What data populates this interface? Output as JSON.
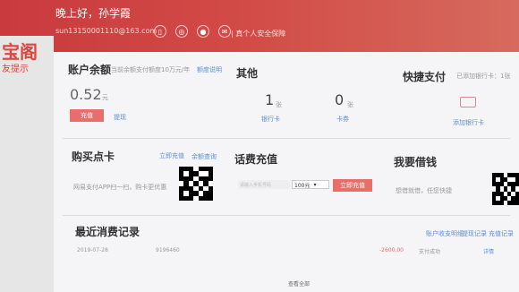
{
  "header": {
    "greeting": "晚上好，孙学霞",
    "email": "sun13150001110@163.com",
    "certified": "| 真个人安全保障"
  },
  "left": {
    "logo_top": "宝阁",
    "logo_bottom": "友提示"
  },
  "balance": {
    "title": "账户余额",
    "note": "当前余额支付额度10万元/年",
    "note_link": "额度说明",
    "amount": "0.52",
    "unit": "元",
    "recharge": "充值",
    "withdraw": "提现"
  },
  "other": {
    "title": "其他",
    "bank_count": "1",
    "bank_unit": "张",
    "bank_label": "银行卡",
    "card_count": "0",
    "card_unit": "张",
    "card_label": "卡券"
  },
  "quick_pay": {
    "title": "快捷支付",
    "note": "已添加银行卡：1张",
    "add_label": "添加银行卡"
  },
  "points_card": {
    "title": "购买点卡",
    "link1": "立即充值",
    "link2": "余额查询",
    "desc": "网易支付APP扫一扫，购卡更优惠"
  },
  "phone": {
    "title": "话费充值",
    "input_placeholder": "请输入手机号码",
    "amount": "100元",
    "button": "立即充值"
  },
  "borrow": {
    "title": "我要借钱",
    "desc": "想借就借，任您快捷"
  },
  "records": {
    "title": "最近消费记录",
    "links": [
      "账户收支明细",
      "提现记录",
      "充值记录"
    ],
    "row": {
      "date": "2019-07-28",
      "id": "9196460",
      "amount": "-2600.00",
      "type": "支付成功",
      "detail": "详情"
    },
    "more": "查看全部"
  },
  "colors": {
    "header": "#c83a3e",
    "button": "#e86e6b",
    "link": "#5b8fd8"
  }
}
